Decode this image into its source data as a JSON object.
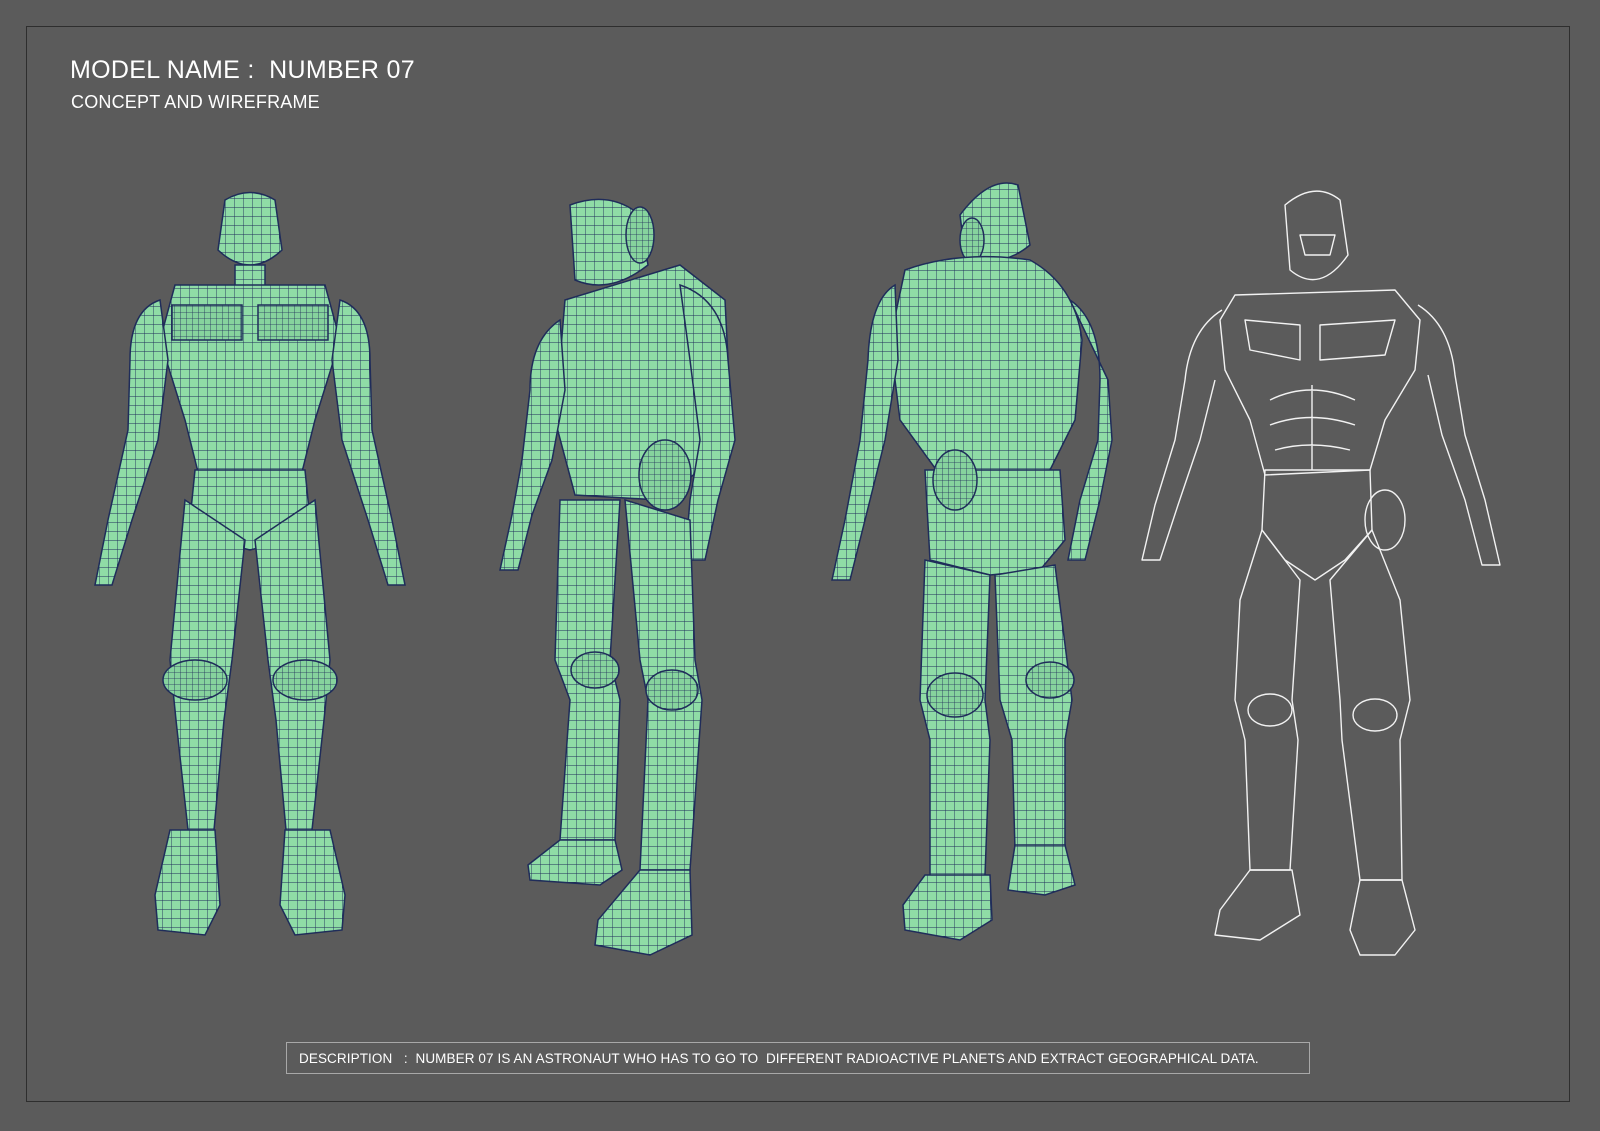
{
  "header": {
    "title": "MODEL NAME :  NUMBER 07",
    "subtitle": "CONCEPT AND WIREFRAME"
  },
  "description": {
    "label": "DESCRIPTION",
    "text": ":  NUMBER 07 IS AN ASTRONAUT WHO HAS TO GO TO  DIFFERENT RADIOACTIVE PLANETS AND EXTRACT GEOGRAPHICAL DATA."
  },
  "colors": {
    "background": "#5b5b5b",
    "mesh_fill": "#8fdca6",
    "mesh_wire": "#1f2c5a",
    "sketch_line": "#f2f2f2"
  }
}
